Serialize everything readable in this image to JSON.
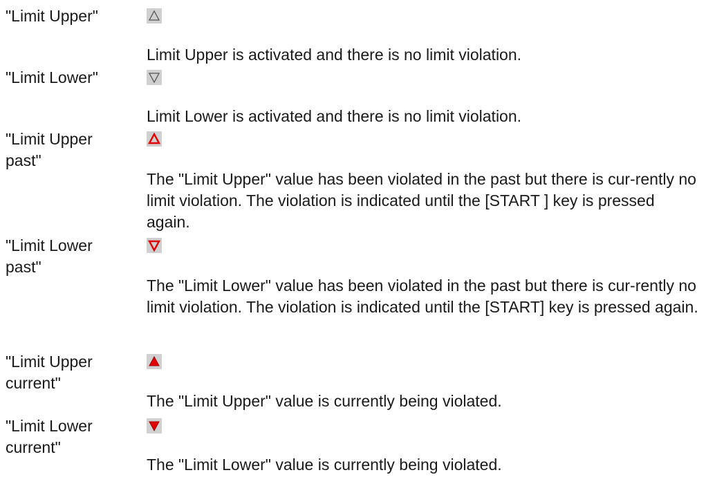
{
  "entries": [
    {
      "term": "\"Limit Upper\"",
      "icon": "triangle-up-outline-icon",
      "description": "Limit Upper is activated and there is no limit violation."
    },
    {
      "term": "\"Limit Lower\"",
      "icon": "triangle-down-outline-icon",
      "description": "Limit Lower is activated and there is no limit violation."
    },
    {
      "term": "\"Limit Upper\npast\"",
      "icon": "triangle-up-red-outline-icon",
      "description": "The \"Limit Upper\" value has been violated in the past but there is cur-rently no limit violation. The violation is indicated until the [START ] key is pressed again."
    },
    {
      "term": "\"Limit Lower\npast\"",
      "icon": "triangle-down-red-outline-icon",
      "description": "The \"Limit Lower\" value has been violated in the past but there is cur-rently no limit violation. The violation is indicated until the [START] key is pressed again."
    },
    {
      "term": "\"Limit Upper\ncurrent\"",
      "icon": "triangle-up-red-filled-icon",
      "description": "The \"Limit Upper\" value is currently being violated."
    },
    {
      "term": "\"Limit Lower\ncurrent\"",
      "icon": "triangle-down-red-filled-icon",
      "description": "The \"Limit Lower\" value is currently being violated."
    }
  ],
  "colors": {
    "icon_background": "#d0d0d0",
    "neutral_outline": "#555555",
    "violation_red": "#e00000",
    "violation_red_border": "#a00000"
  }
}
